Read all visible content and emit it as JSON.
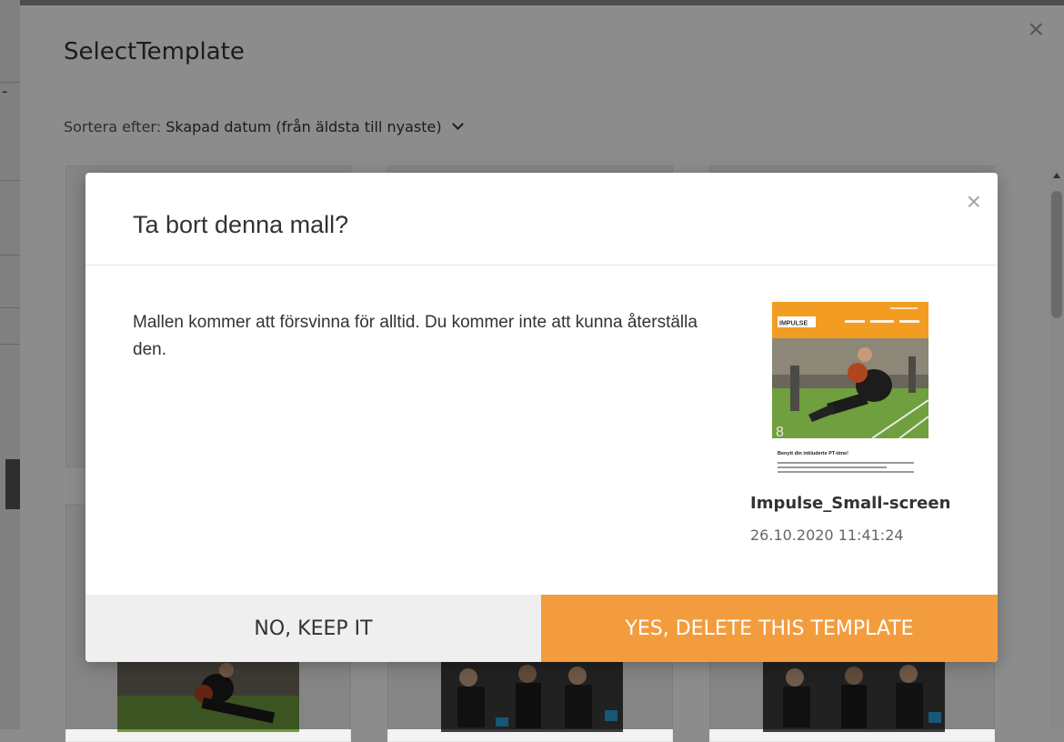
{
  "panel": {
    "title": "SelectTemplate",
    "sort_label": "Sortera efter:",
    "sort_value": "Skapad datum (från äldsta till nyaste)"
  },
  "dialog": {
    "title": "Ta bort denna mall?",
    "message": "Mallen kommer att försvinna för alltid. Du kommer inte att kunna återställa den.",
    "template": {
      "name": "Impulse_Small-screen",
      "date": "26.10.2020 11:41:24",
      "preview": {
        "logo": "IMPULSE",
        "headline": "Benytt din inkluderte PT-time!"
      }
    },
    "keep_label": "NO, KEEP IT",
    "delete_label": "YES, DELETE THIS TEMPLATE"
  },
  "colors": {
    "accent": "#f39c3d",
    "keep_bg": "#efefef"
  }
}
